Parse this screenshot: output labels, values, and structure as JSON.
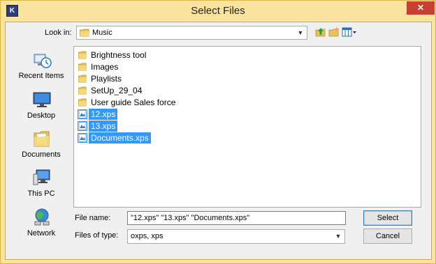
{
  "window": {
    "title": "Select Files",
    "app_icon_letter": "K",
    "close_symbol": "✕"
  },
  "lookin": {
    "label": "Look in:",
    "value": "Music"
  },
  "toolbar": {
    "icons": [
      "up-folder-icon",
      "new-folder-icon",
      "view-menu-icon"
    ]
  },
  "places": [
    {
      "label": "Recent Items",
      "icon": "recent-items-icon"
    },
    {
      "label": "Desktop",
      "icon": "desktop-icon"
    },
    {
      "label": "Documents",
      "icon": "documents-icon"
    },
    {
      "label": "This PC",
      "icon": "this-pc-icon"
    },
    {
      "label": "Network",
      "icon": "network-icon"
    }
  ],
  "files": [
    {
      "name": "Brightness tool",
      "kind": "folder",
      "selected": false
    },
    {
      "name": "Images",
      "kind": "folder",
      "selected": false
    },
    {
      "name": "Playlists",
      "kind": "folder",
      "selected": false
    },
    {
      "name": "SetUp_29_04",
      "kind": "folder",
      "selected": false
    },
    {
      "name": "User guide Sales force",
      "kind": "folder",
      "selected": false
    },
    {
      "name": "12.xps",
      "kind": "xps",
      "selected": true
    },
    {
      "name": "13.xps",
      "kind": "xps",
      "selected": true
    },
    {
      "name": "Documents.xps",
      "kind": "xps",
      "selected": true
    }
  ],
  "form": {
    "file_name_label": "File name:",
    "file_name_value": "\"12.xps\" \"13.xps\" \"Documents.xps\"",
    "file_type_label": "Files of type:",
    "file_type_value": "oxps, xps"
  },
  "buttons": {
    "select": "Select",
    "cancel": "Cancel"
  },
  "colors": {
    "frame": "#fae39c",
    "selection": "#3399ff",
    "close": "#c84031"
  }
}
